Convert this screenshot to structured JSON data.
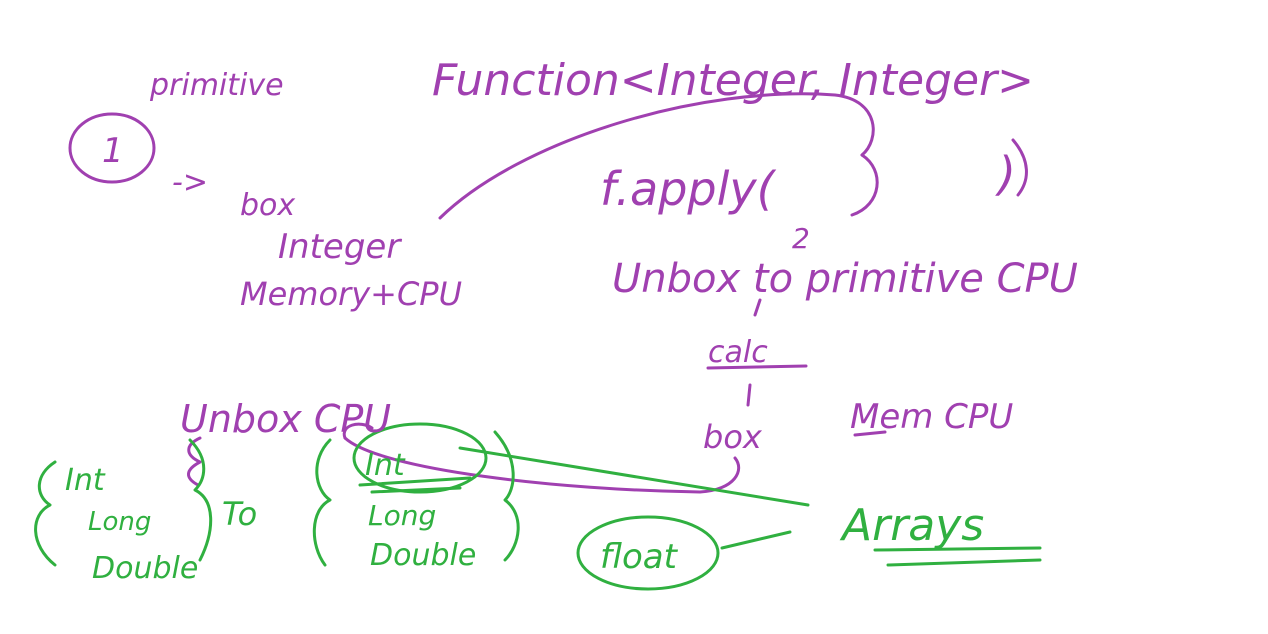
{
  "colors": {
    "purple_ink": "#a040b0",
    "green_ink": "#30b040",
    "background": "#ffffff"
  },
  "notes": {
    "step_one": "1",
    "primitive": "primitive",
    "arrow": "->",
    "box": "box",
    "integer": "Integer",
    "memory_cpu": "Memory+CPU",
    "function_sig": "Function<Integer, Integer>",
    "apply_call": "f.apply(",
    "apply_close": ")",
    "step_two": "2",
    "unbox_to_primitive": "Unbox to primitive CPU",
    "calc": "calc",
    "box2": "box",
    "mem_cpu": "Mem CPU",
    "unbox_cpu": "Unbox CPU",
    "left_types": [
      "Int",
      "Long",
      "Double"
    ],
    "to": "To",
    "right_types": [
      "Int",
      "Long",
      "Double"
    ],
    "float": "float",
    "arrays": "Arrays"
  }
}
